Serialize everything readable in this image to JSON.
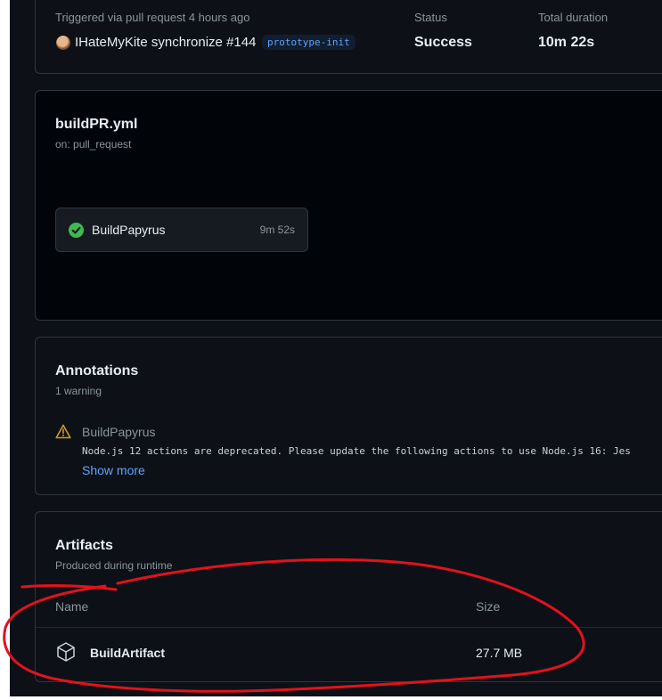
{
  "run_summary": {
    "trigger_text": "Triggered via pull request 4 hours ago",
    "actor_text": "IHateMyKite synchronize #144",
    "branch": "prototype-init",
    "status_label": "Status",
    "status_value": "Success",
    "duration_label": "Total duration",
    "duration_value": "10m 22s"
  },
  "workflow": {
    "file": "buildPR.yml",
    "trigger": "on: pull_request",
    "jobs": [
      {
        "name": "BuildPapyrus",
        "duration": "9m 52s",
        "status": "success"
      }
    ]
  },
  "annotations": {
    "title": "Annotations",
    "count_text": "1 warning",
    "items": [
      {
        "type": "warning",
        "title": "BuildPapyrus",
        "message": "Node.js 12 actions are deprecated. Please update the following actions to use Node.js 16: Jes",
        "show_more": "Show more"
      }
    ]
  },
  "artifacts": {
    "title": "Artifacts",
    "subtitle": "Produced during runtime",
    "columns": [
      "Name",
      "Size"
    ],
    "rows": [
      {
        "name": "BuildArtifact",
        "size": "27.7 MB"
      }
    ]
  },
  "colors": {
    "background": "#0d1117",
    "success": "#3fb950",
    "warning": "#d29922",
    "link": "#58a6ff",
    "scribble": "#e3121b"
  }
}
